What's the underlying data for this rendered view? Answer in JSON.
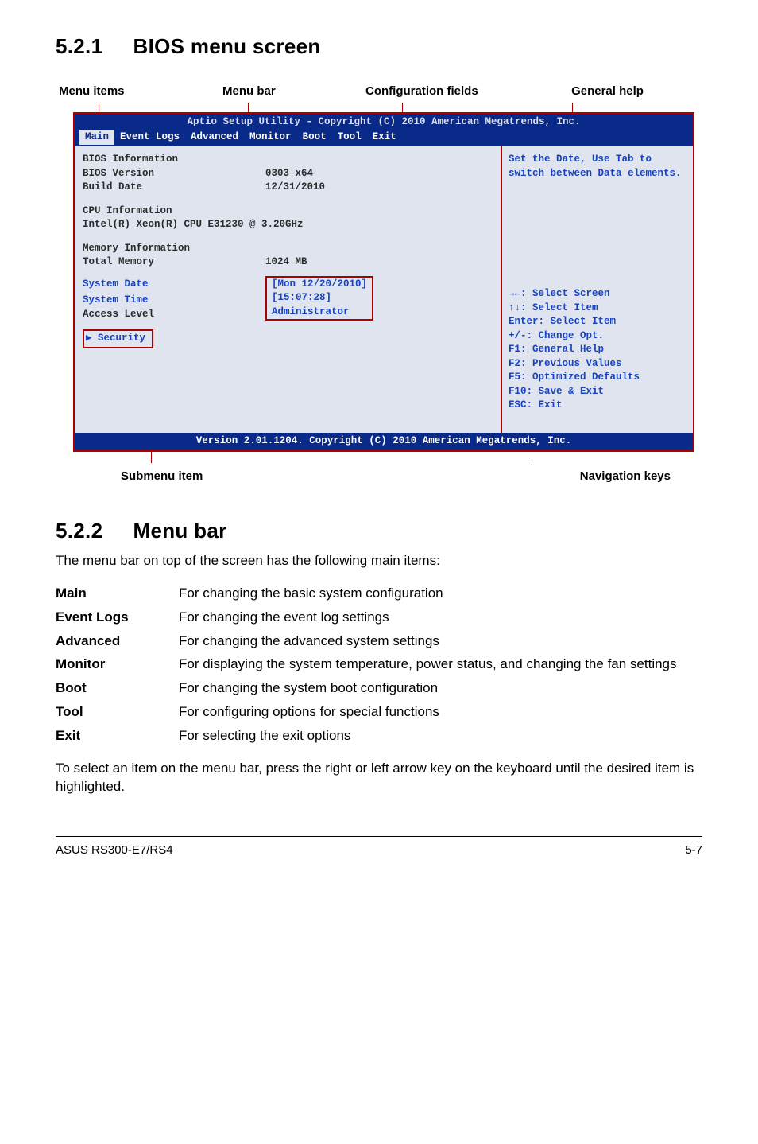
{
  "sec1": {
    "num": "5.2.1",
    "title": "BIOS menu screen"
  },
  "labels": {
    "items": "Menu items",
    "bar": "Menu bar",
    "cfg": "Configuration fields",
    "help": "General help",
    "sub": "Submenu item",
    "nav": "Navigation keys"
  },
  "bios": {
    "util": "Aptio Setup Utility - Copyright (C) 2010 American Megatrends, Inc.",
    "tabs": [
      "Main",
      "Event Logs",
      "Advanced",
      "Monitor",
      "Boot",
      "Tool",
      "Exit"
    ],
    "left": {
      "biosinfo": "BIOS Information",
      "biosver_k": "BIOS Version",
      "biosver_v": "0303 x64",
      "builddate_k": "Build Date",
      "builddate_v": "12/31/2010",
      "cpuinfo": "CPU Information",
      "cpu": "Intel(R) Xeon(R) CPU E31230 @ 3.20GHz",
      "meminfo": "Memory Information",
      "totalmem_k": "Total Memory",
      "totalmem_v": "1024 MB",
      "sysdate_k": "System Date",
      "sysdate_v": "[Mon 12/20/2010]",
      "systime_k": "System Time",
      "systime_v": "[15:07:28]",
      "access_k": "Access Level",
      "access_v": "Administrator",
      "security": "▶ Security"
    },
    "right": {
      "help1": "Set the Date, Use Tab to",
      "help2": "switch between Data elements.",
      "nav": [
        "→←: Select Screen",
        "↑↓:  Select Item",
        "Enter: Select Item",
        "+/-: Change Opt.",
        "F1: General Help",
        "F2: Previous Values",
        "F5: Optimized Defaults",
        "F10: Save & Exit",
        "ESC: Exit"
      ]
    },
    "footer": "Version 2.01.1204. Copyright (C) 2010 American Megatrends, Inc."
  },
  "sec2": {
    "num": "5.2.2",
    "title": "Menu bar"
  },
  "menubar_intro": "The menu bar on top of the screen has the following main items:",
  "menubar": [
    {
      "k": "Main",
      "v": "For changing the basic system configuration"
    },
    {
      "k": "Event Logs",
      "v": "For changing the event log settings"
    },
    {
      "k": "Advanced",
      "v": "For changing the advanced system settings"
    },
    {
      "k": "Monitor",
      "v": "For displaying the system temperature, power status, and changing the fan settings"
    },
    {
      "k": "Boot",
      "v": "For changing the system boot configuration"
    },
    {
      "k": "Tool",
      "v": "For configuring options for special functions"
    },
    {
      "k": "Exit",
      "v": "For selecting the exit options"
    }
  ],
  "closing": "To select an item on the menu bar, press the right or left arrow key on the keyboard until the desired item is highlighted.",
  "footer": {
    "left": "ASUS RS300-E7/RS4",
    "right": "5-7"
  }
}
